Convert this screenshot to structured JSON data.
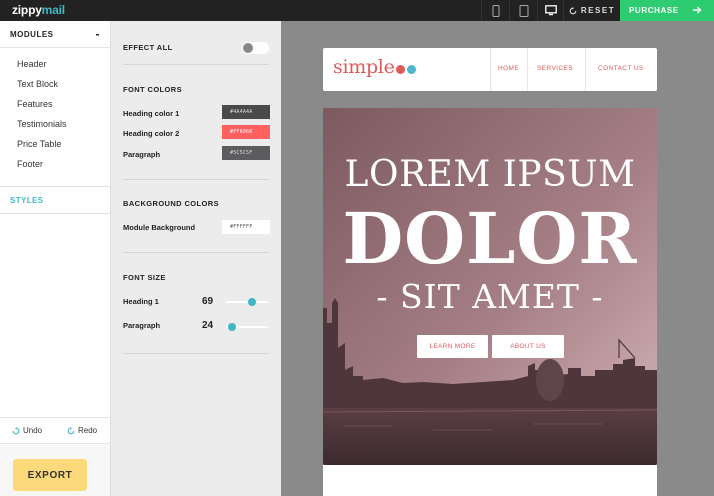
{
  "app": {
    "logo_main": "zippy",
    "logo_accent": "mail"
  },
  "topbar": {
    "reset_label": "RESET",
    "purchase_label": "PURCHASE",
    "devices": [
      "phone-icon",
      "tablet-icon",
      "desktop-icon"
    ],
    "active_device": "desktop"
  },
  "sidebar": {
    "modules_title": "MODULES",
    "collapse_symbol": "-",
    "items": [
      {
        "label": "Header"
      },
      {
        "label": "Text Block"
      },
      {
        "label": "Features"
      },
      {
        "label": "Testimonials"
      },
      {
        "label": "Price Table"
      },
      {
        "label": "Footer"
      }
    ],
    "styles_label": "STYLES",
    "undo_label": "Undo",
    "redo_label": "Redo",
    "export_label": "EXPORT"
  },
  "panel": {
    "effect_all_label": "EFFECT ALL",
    "effect_all_on": false,
    "font_colors_title": "FONT COLORS",
    "font_colors": [
      {
        "label": "Heading color 1",
        "value": "#4A4A4A"
      },
      {
        "label": "Heading color 2",
        "value": "#FF6060"
      },
      {
        "label": "Paragraph",
        "value": "#5C5C5F"
      }
    ],
    "bg_colors_title": "BACKGROUND COLORS",
    "module_bg_label": "Module Background",
    "module_bg_value": "#FFFFFF",
    "font_size_title": "FONT SIZE",
    "font_sizes": [
      {
        "label": "Heading 1",
        "value": "69",
        "fraction": 0.62
      },
      {
        "label": "Paragraph",
        "value": "24",
        "fraction": 0.15
      }
    ]
  },
  "preview": {
    "brand": "simple",
    "brand_dot_colors": [
      "#e05a5a",
      "#4fb6c9"
    ],
    "nav_links": [
      "HOME",
      "SERVICES",
      "CONTACT US"
    ],
    "hero_line1": "LOREM IPSUM",
    "hero_line2": "DOLOR",
    "hero_line3": "- SIT AMET -",
    "btn_learn_more": "LEARN MORE",
    "btn_about_us": "ABOUT US"
  },
  "colors": {
    "accent": "#3fb8c4",
    "purchase": "#2ecc71",
    "export": "#fcd97a",
    "brand_red": "#e05a5a"
  }
}
